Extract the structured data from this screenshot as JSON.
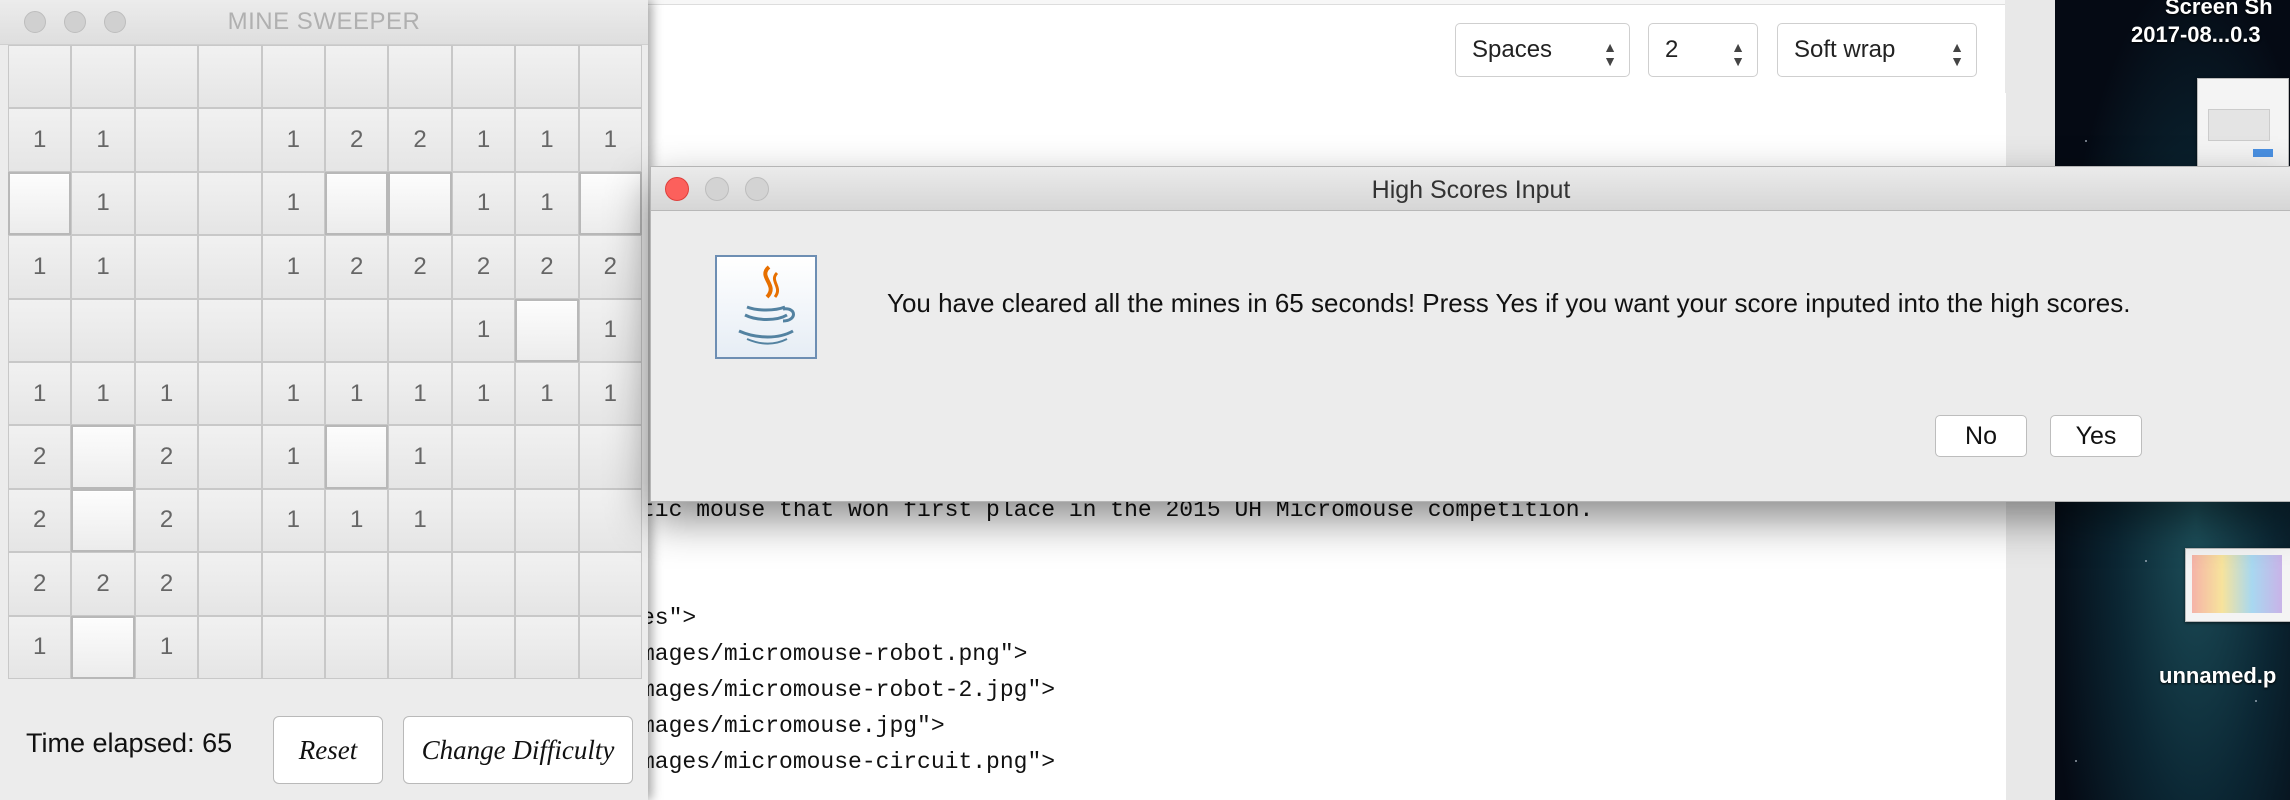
{
  "desktop": {
    "label1_line1": "Screen Sh",
    "label1_line2": "2017-08...0.3",
    "label2": "unnamed.p"
  },
  "editor": {
    "indent_select": "Spaces",
    "size_select": "2",
    "wrap_select": "Soft wrap",
    "code_lines": [
      "tic mouse that won first place in the 2015 UH Micromouse competition.",
      "es\">",
      "mages/micromouse-robot.png\">",
      "mages/micromouse-robot-2.jpg\">",
      "mages/micromouse.jpg\">",
      "mages/micromouse-circuit.png\">"
    ]
  },
  "minesweeper": {
    "title": "MINE SWEEPER",
    "board": [
      [
        "",
        "",
        "",
        "",
        "",
        "",
        "",
        "",
        "",
        ""
      ],
      [
        "1",
        "1",
        "",
        "",
        "1",
        "2",
        "2",
        "1",
        "1",
        "1"
      ],
      [
        "#",
        "1",
        "",
        "",
        "1",
        "#",
        "#",
        "1",
        "1",
        "#"
      ],
      [
        "1",
        "1",
        "",
        "",
        "1",
        "2",
        "2",
        "2",
        "2",
        "2"
      ],
      [
        "",
        "",
        "",
        "",
        "",
        "",
        "",
        "1",
        "#",
        "1"
      ],
      [
        "1",
        "1",
        "1",
        "",
        "1",
        "1",
        "1",
        "1",
        "1",
        "1"
      ],
      [
        "2",
        "#",
        "2",
        "",
        "1",
        "#",
        "1",
        "",
        "",
        ""
      ],
      [
        "2",
        "#",
        "2",
        "",
        "1",
        "1",
        "1",
        "",
        "",
        ""
      ],
      [
        "2",
        "2",
        "2",
        "",
        "",
        "",
        "",
        "",
        "",
        ""
      ],
      [
        "1",
        "#",
        "1",
        "",
        "",
        "",
        "",
        "",
        "",
        ""
      ]
    ],
    "time_elapsed": "Time elapsed: 65",
    "reset_label": "Reset",
    "change_difficulty_label": "Change Difficulty"
  },
  "dialog": {
    "title": "High Scores Input",
    "message": "You have cleared all the mines in 65 seconds! Press Yes if you want your score inputed into the high scores.",
    "no_label": "No",
    "yes_label": "Yes",
    "icon": "java-coffee-cup-icon"
  }
}
